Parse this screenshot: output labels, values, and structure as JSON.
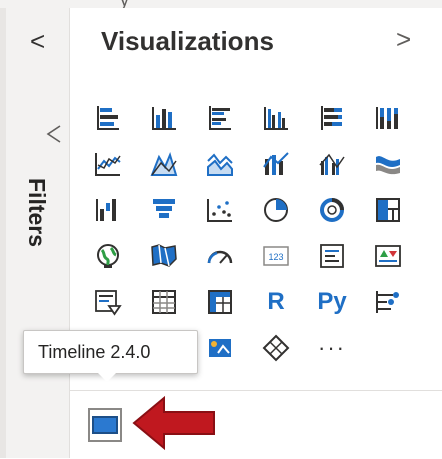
{
  "top_strip": {
    "glyph": "y"
  },
  "filters_pane": {
    "collapse_label": "<",
    "label": "Filters",
    "icon": "filter-icon"
  },
  "visualizations": {
    "title": "Visualizations",
    "expand_label": ">",
    "icons": [
      [
        "stacked-bar-chart-icon",
        "stacked-column-chart-icon",
        "clustered-bar-chart-icon",
        "clustered-column-chart-icon",
        "100-stacked-bar-chart-icon",
        "100-stacked-column-chart-icon"
      ],
      [
        "line-chart-icon",
        "area-chart-icon",
        "stacked-area-chart-icon",
        "line-and-stacked-column-chart-icon",
        "line-and-clustered-column-chart-icon",
        "ribbon-chart-icon"
      ],
      [
        "waterfall-chart-icon",
        "funnel-icon",
        "scatter-chart-icon",
        "pie-chart-icon",
        "donut-chart-icon",
        "treemap-icon"
      ],
      [
        "map-icon",
        "filled-map-icon",
        "gauge-icon",
        "card-icon",
        "multi-row-card-icon",
        "kpi-icon"
      ],
      [
        "slicer-icon",
        "table-icon",
        "matrix-icon",
        "r-visual-icon",
        "python-visual-icon",
        "key-influencers-icon"
      ],
      [
        "decomposition-tree-icon",
        "qa-icon",
        "smart-narrative-icon",
        "paginated-report-icon",
        "power-apps-icon",
        "more-options-icon"
      ]
    ],
    "r_label": "R",
    "py_label": "Py",
    "more_label": "···"
  },
  "tooltip": {
    "text": "Timeline 2.4.0"
  },
  "custom_visual": {
    "icon": "timeline-visual-icon"
  },
  "colors": {
    "accent_blue": "#1f6fc5",
    "pane_bg": "#f3f2f1",
    "arrow_red": "#c0181f",
    "kpi_green": "#2e9e45",
    "kpi_red": "#d13438"
  }
}
